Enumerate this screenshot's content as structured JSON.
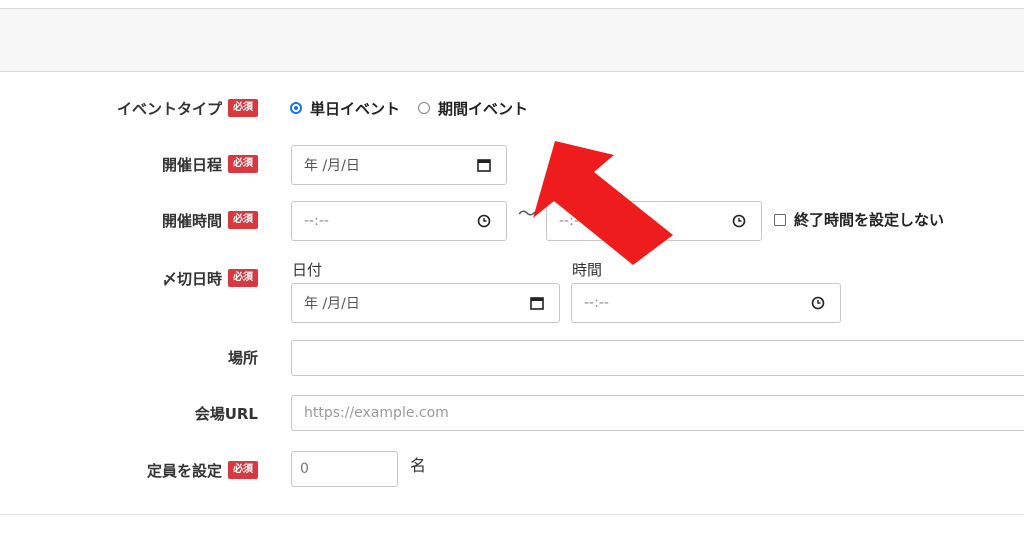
{
  "form": {
    "event_type": {
      "label": "イベントタイプ",
      "required": "必須",
      "options": [
        {
          "label": "単日イベント",
          "selected": true
        },
        {
          "label": "期間イベント",
          "selected": false
        }
      ]
    },
    "date": {
      "label": "開催日程",
      "required": "必須",
      "value": "年 /月/日",
      "icon": "calendar-icon"
    },
    "time": {
      "label": "開催時間",
      "required": "必須",
      "start_value": "--:--",
      "separator": "〜",
      "end_value": "--:--",
      "icon": "clock-icon",
      "no_end_label": "終了時間を設定しない"
    },
    "deadline": {
      "label": "〆切日時",
      "required": "必須",
      "date_label": "日付",
      "date_value": "年 /月/日",
      "time_label": "時間",
      "time_value": "--:--"
    },
    "place": {
      "label": "場所",
      "value": ""
    },
    "venue_url": {
      "label": "会場URL",
      "placeholder": "https://example.com"
    },
    "capacity": {
      "label": "定員を設定",
      "required": "必須",
      "value": "0",
      "unit": "名"
    }
  },
  "colors": {
    "required_badge": "#d9393e",
    "radio_accent": "#1a73e8",
    "arrow": "#ee1c1c"
  }
}
